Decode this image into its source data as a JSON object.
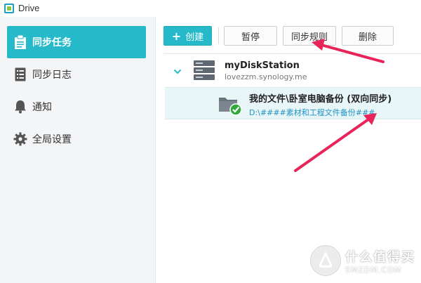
{
  "app": {
    "title": "Drive"
  },
  "sidebar": {
    "items": [
      {
        "label": "同步任务",
        "icon": "clipboard-icon",
        "active": true
      },
      {
        "label": "同步日志",
        "icon": "log-list-icon",
        "active": false
      },
      {
        "label": "通知",
        "icon": "bell-icon",
        "active": false
      },
      {
        "label": "全局设置",
        "icon": "gear-icon",
        "active": false
      }
    ]
  },
  "toolbar": {
    "create_label": "创建",
    "pause_label": "暂停",
    "sync_rules_label": "同步规则",
    "delete_label": "删除"
  },
  "server": {
    "name": "myDiskStation",
    "host": "lovezzm.synology.me"
  },
  "task": {
    "name": "我的文件\\卧室电脑备份 (双向同步)",
    "path": "D:\\####素材和工程文件备份###"
  },
  "watermark": {
    "cn": "什么值得买",
    "en": "SMZDM.COM"
  },
  "colors": {
    "accent": "#25b9c9",
    "annotation_arrow": "#e8245a",
    "path_text": "#1c93c6",
    "status_ok": "#2eaa3c"
  }
}
